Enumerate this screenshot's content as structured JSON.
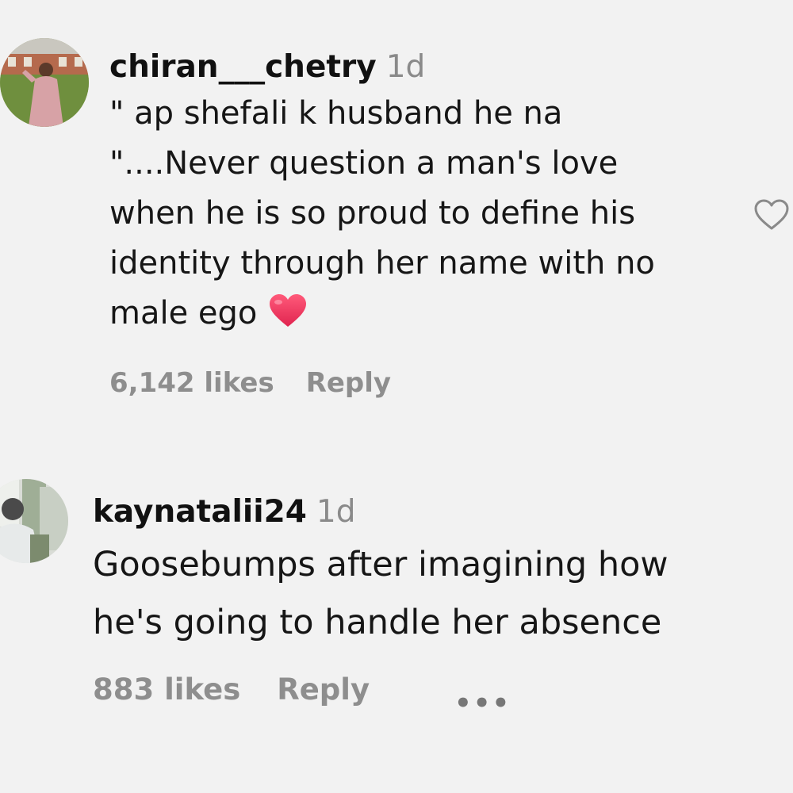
{
  "comments": [
    {
      "username": "chiran___chetry",
      "timestamp": "1d",
      "lines": [
        "\" ap shefali k husband he na",
        "\"....Never question a man's love",
        "when he is so proud to define his",
        "identity through her name with no",
        "male ego"
      ],
      "emoji": "heart-emoji",
      "likes": "6,142 likes",
      "reply_label": "Reply",
      "like_icon": "heart-outline-icon"
    },
    {
      "username": "kaynatalii24",
      "timestamp": "1d",
      "lines": [
        "Goosebumps after imagining how",
        "he's going to handle her absence"
      ],
      "likes": "883 likes",
      "reply_label": "Reply",
      "more_label": "•••"
    }
  ],
  "colors": {
    "background": "#f2f2f2",
    "username": "#111111",
    "meta": "#8e8e8e",
    "heart": "#e8365d"
  }
}
